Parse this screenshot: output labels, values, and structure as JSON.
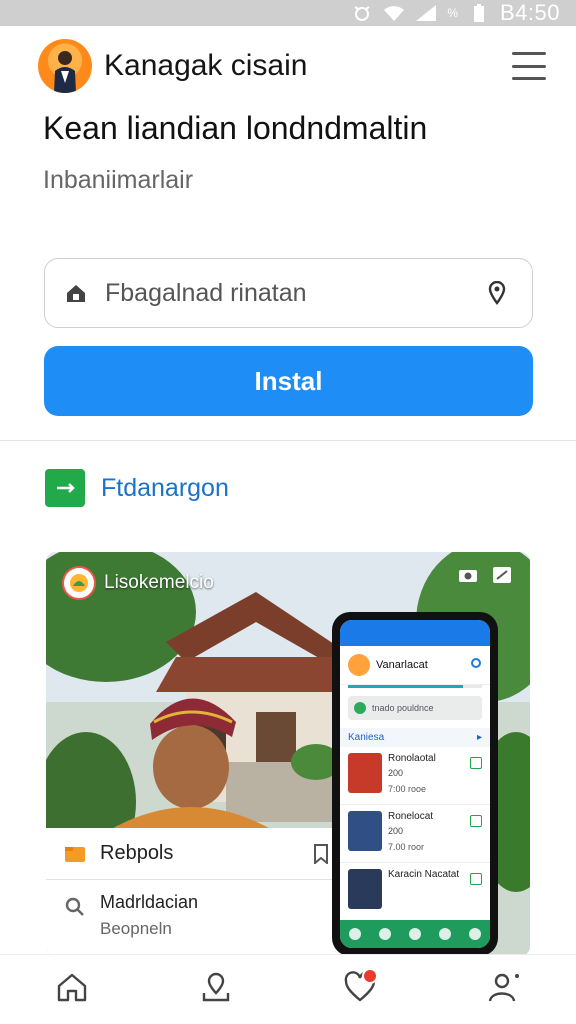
{
  "status_bar": {
    "time": "B4:50",
    "network_label": "%"
  },
  "header": {
    "app_title": "Kanagak cisain"
  },
  "hero": {
    "headline": "Kean liandian londndmaltin",
    "subline": "Inbaniimarlair"
  },
  "search": {
    "text": "Fbagalnad rinatan"
  },
  "install_button": {
    "label": "Instal"
  },
  "section": {
    "label": "Ftdanargon"
  },
  "card": {
    "brand": "Lisokemelcio",
    "list": [
      {
        "label": "Rebpols"
      },
      {
        "title": "Madrldacian",
        "subtitle": "Beopneln"
      }
    ],
    "phone": {
      "title": "Vanarlacat",
      "progress": 0.86,
      "search_text": "tnado pouldnce",
      "section_title": "Kaniesa",
      "items": [
        {
          "name": "Ronolaotal",
          "line1": "200",
          "line2": "7:00",
          "line3": "rooe"
        },
        {
          "name": "Ronelocat",
          "line1": "200",
          "line2": "7.00",
          "line3": "roor"
        },
        {
          "name": "Karacin Nacatat",
          "line1": "",
          "line2": "",
          "line3": ""
        }
      ]
    }
  },
  "colors": {
    "primary": "#1f8df6",
    "section_icon": "#22a94a",
    "section_label": "#1a73c8",
    "notification_badge": "#ea3b2e"
  },
  "icons": {
    "header_menu": "hamburger-icon",
    "search_lead": "home-lock-icon",
    "search_trail": "location-pin-icon",
    "nav": [
      "home-icon",
      "map-pin-icon",
      "heart-icon",
      "profile-icon"
    ]
  }
}
